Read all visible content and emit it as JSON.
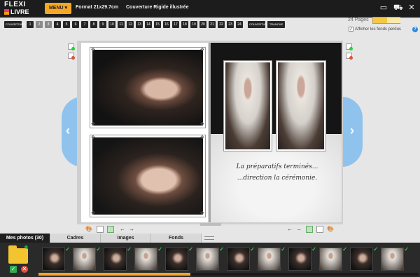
{
  "app": {
    "logo_line1": "FLEXI",
    "logo_line2": "LIVRE",
    "menu_label": "MENU ▾",
    "format_text": "Format 21x29.7cm",
    "cover_text": "Couverture Rigide illustrée"
  },
  "top_icons": [
    "monitor-icon",
    "cart-icon",
    "close-icon"
  ],
  "pagebar": {
    "cover_front": "COUVERTURE",
    "pages": [
      "1",
      "2",
      "3",
      "4",
      "5",
      "6",
      "7",
      "8",
      "9",
      "10",
      "11",
      "12",
      "13",
      "14",
      "15",
      "16",
      "17",
      "18",
      "19",
      "20",
      "21",
      "22",
      "23",
      "24"
    ],
    "selected_pages": [
      "2",
      "3"
    ],
    "cover_back": "COUVERTURE",
    "tranche": "TRANCHE"
  },
  "view": {
    "pages_count": "24 Pages",
    "show_lost_backgrounds_label": "Afficher les fonds perdus",
    "show_lost_backgrounds_checked": true
  },
  "book": {
    "caption_line1": "La préparatifs terminés...",
    "caption_line2": "...direction la cérémonie."
  },
  "tabs": [
    "Mes photos (30)",
    "Cadres",
    "Images",
    "Fonds"
  ],
  "active_tab": "Mes photos (30)",
  "tray": {
    "thumb_count": 12,
    "upload_progress_fraction": 0.4
  },
  "colors": {
    "accent": "#f5a623",
    "topbar": "#1c1c1c",
    "nav_arrow": "#8fc3ee",
    "check": "#2ecc40"
  }
}
